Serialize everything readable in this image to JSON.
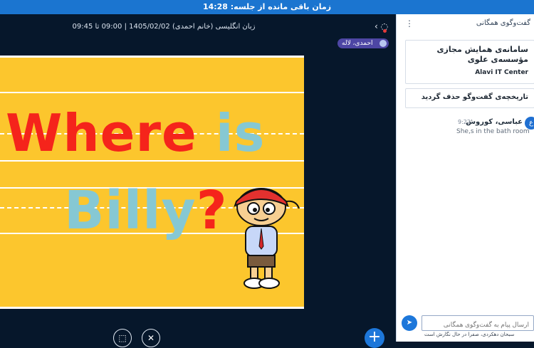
{
  "session": {
    "remaining_label": "زمان باقی مانده از جلسه: 14:28"
  },
  "meeting": {
    "title": "زبان انگلیسی (خانم احمدی) 1405/02/02 | 09:00 تا 09:45"
  },
  "presenter": {
    "label": "احمدی، لاله"
  },
  "slide": {
    "line1_main": "Where ",
    "line1_is": "is",
    "line2_main": "Billy",
    "line2_q": "?"
  },
  "chat": {
    "title": "گفت‌وگوی همگانی",
    "welcome_title": "سامانه‌ی همایش مجازی مؤسسه‌ی علوی",
    "welcome_brand": "Alavi IT Center",
    "history_notice": "تاریخچه‌ی گفت‌وگو حذف گردید",
    "message": {
      "author": "عباسی، کوروش",
      "time": "9:22",
      "text": "She,s in the bath room",
      "avatar": "ع"
    },
    "input_placeholder": "ارسال پیام به گفت‌وگوی همگانی",
    "typing_notice": "سبحان دهکردی، صفرا در حال نگارش است"
  },
  "icons": {
    "close": "×",
    "menu": "⋮",
    "send": "➤",
    "plus": "+",
    "chevron": "‹"
  }
}
